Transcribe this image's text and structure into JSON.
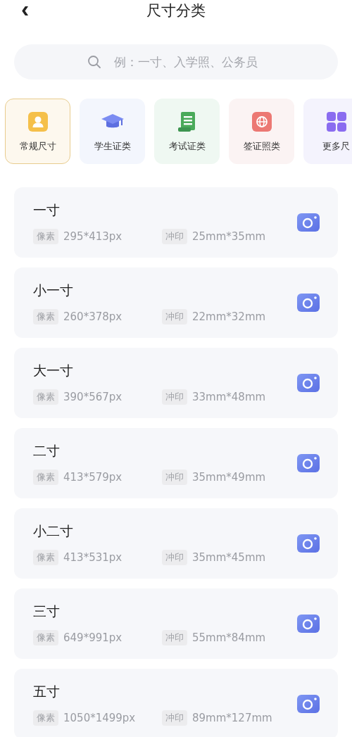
{
  "header": {
    "back": "‹",
    "title": "尺寸分类"
  },
  "search": {
    "placeholder": "例：一寸、入学照、公务员"
  },
  "categories": [
    {
      "label": "常规尺寸",
      "kind": "person",
      "selected": true
    },
    {
      "label": "学生证类",
      "kind": "cap",
      "selected": false
    },
    {
      "label": "考试证类",
      "kind": "scroll",
      "selected": false
    },
    {
      "label": "签证照类",
      "kind": "globe",
      "selected": false
    },
    {
      "label": "更多尺",
      "kind": "grid",
      "selected": false
    }
  ],
  "sizes": [
    {
      "name": "一寸",
      "pixel_tag": "像素",
      "pixels": "295*413px",
      "print_tag": "冲印",
      "print": "25mm*35mm"
    },
    {
      "name": "小一寸",
      "pixel_tag": "像素",
      "pixels": "260*378px",
      "print_tag": "冲印",
      "print": "22mm*32mm"
    },
    {
      "name": "大一寸",
      "pixel_tag": "像素",
      "pixels": "390*567px",
      "print_tag": "冲印",
      "print": "33mm*48mm"
    },
    {
      "name": "二寸",
      "pixel_tag": "像素",
      "pixels": "413*579px",
      "print_tag": "冲印",
      "print": "35mm*49mm"
    },
    {
      "name": "小二寸",
      "pixel_tag": "像素",
      "pixels": "413*531px",
      "print_tag": "冲印",
      "print": "35mm*45mm"
    },
    {
      "name": "三寸",
      "pixel_tag": "像素",
      "pixels": "649*991px",
      "print_tag": "冲印",
      "print": "55mm*84mm"
    },
    {
      "name": "五寸",
      "pixel_tag": "像素",
      "pixels": "1050*1499px",
      "print_tag": "冲印",
      "print": "89mm*127mm"
    }
  ]
}
